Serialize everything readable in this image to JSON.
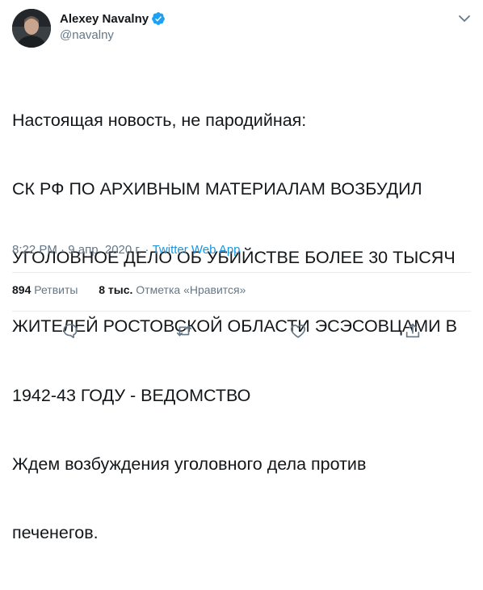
{
  "author": {
    "name": "Alexey Navalny",
    "handle": "@navalny"
  },
  "tweet": {
    "lines": [
      "Настоящая новость, не пародийная:",
      "СК РФ ПО АРХИВНЫМ МАТЕРИАЛАМ ВОЗБУДИЛ",
      "УГОЛОВНОЕ ДЕЛО ОБ УБИЙСТВЕ БОЛЕЕ 30 ТЫСЯЧ",
      "ЖИТЕЛЕЙ РОСТОВСКОЙ ОБЛАСТИ ЭСЭСОВЦАМИ В",
      "1942-43 ГОДУ - ВЕДОМСТВО",
      "Ждем возбуждения уголовного дела против",
      "печенегов."
    ],
    "time": "8:22 PM",
    "separator": " · ",
    "date": "9 апр. 2020 г.",
    "source": "Twitter Web App"
  },
  "stats": {
    "retweets_count": "894",
    "retweets_label": "Ретвиты",
    "likes_count": "8 тыс.",
    "likes_label": "Отметка «Нравится»"
  },
  "icons": {
    "verified": "verified-badge-icon",
    "more": "chevron-down-icon",
    "reply": "reply-icon",
    "retweet": "retweet-icon",
    "like": "heart-icon",
    "share": "share-icon"
  },
  "colors": {
    "accent": "#1da1f2",
    "link": "#1b95e0",
    "secondary_text": "#657786",
    "divider": "#e6ecf0"
  }
}
